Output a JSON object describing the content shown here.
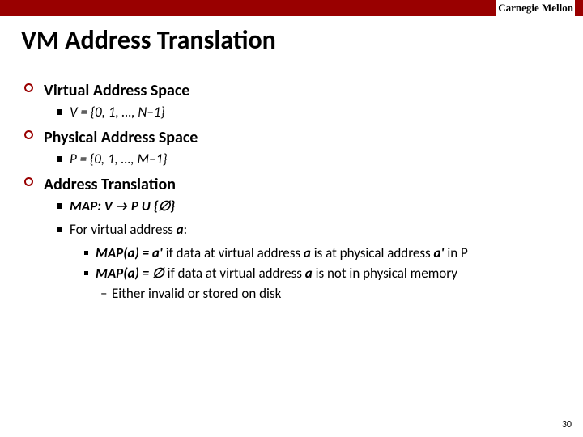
{
  "header": {
    "brand": "Carnegie Mellon"
  },
  "title": "VM Address Translation",
  "sections": {
    "s1": {
      "heading": "Virtual Address Space",
      "line": "V = {0, 1, …, N–1}"
    },
    "s2": {
      "heading": "Physical Address Space",
      "line": "P = {0, 1, …, M–1}"
    },
    "s3": {
      "heading": "Address Translation",
      "map_label": "MAP:  V  →  P  U  {∅}",
      "forline_prefix": "For virtual address ",
      "forline_a": "a",
      "forline_suffix": ":",
      "m1_lhs": "MAP(a)  =  a'",
      "m1_mid": "  if data at virtual address ",
      "m1_a": "a",
      "m1_mid2": " is at physical address ",
      "m1_ap": "a'",
      "m1_tail": " in P",
      "m2_lhs": "MAP(a)  =  ∅ ",
      "m2_mid": "if data at virtual address ",
      "m2_a": "a",
      "m2_tail": " is not in physical memory",
      "either": "Either invalid or stored on disk"
    }
  },
  "page_number": "30"
}
